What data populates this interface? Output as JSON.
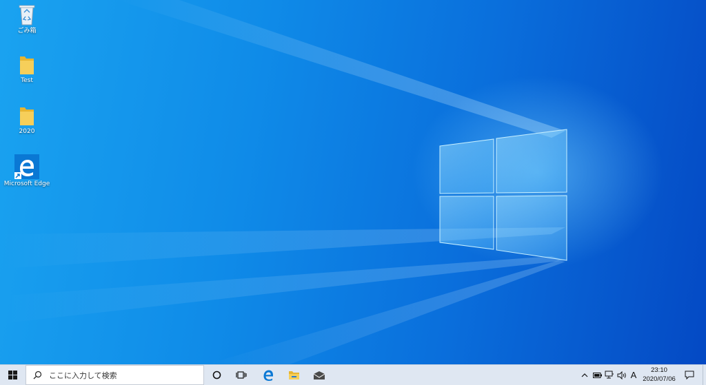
{
  "desktop": {
    "wallpaper": "windows-10-hero-blue",
    "icons": [
      {
        "label": "ごみ箱",
        "icon": "recycle-bin-icon"
      },
      {
        "label": "Test",
        "icon": "folder-icon"
      },
      {
        "label": "2020",
        "icon": "folder-icon"
      },
      {
        "label": "Microsoft Edge",
        "icon": "edge-icon"
      }
    ]
  },
  "taskbar": {
    "start_icon": "windows-start-icon",
    "search": {
      "placeholder": "ここに入力して検索",
      "icon": "search-icon"
    },
    "pinned": [
      {
        "name": "cortana",
        "icon": "cortana-circle-icon"
      },
      {
        "name": "task-view",
        "icon": "task-view-icon"
      },
      {
        "name": "edge",
        "icon": "edge-icon"
      },
      {
        "name": "file-explorer",
        "icon": "folder-icon"
      },
      {
        "name": "mail",
        "icon": "mail-icon"
      }
    ],
    "tray": {
      "ime": "A",
      "time": "23:10",
      "date": "2020/07/06"
    }
  },
  "colors": {
    "taskbar_bg": "#dfe7f2",
    "edge_blue": "#0a78d4",
    "folder_yellow": "#f4c64a",
    "wallpaper_blue": "#0f8be8"
  }
}
